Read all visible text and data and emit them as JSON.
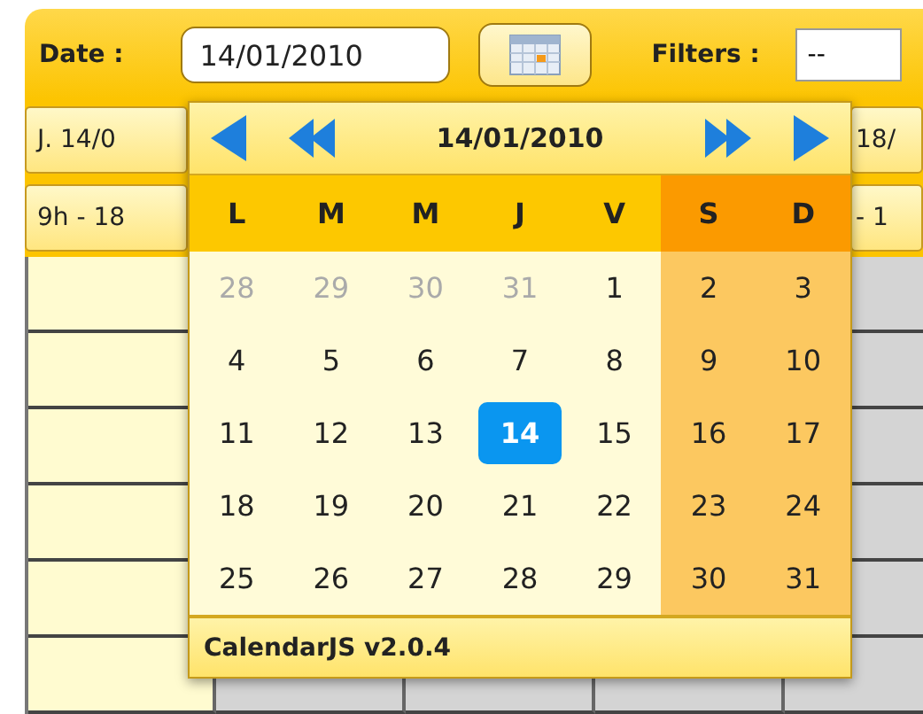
{
  "toolbar": {
    "date_label": "Date :",
    "date_value": "14/01/2010",
    "filters_label": "Filters :",
    "filters_value": "--"
  },
  "header_rows": [
    {
      "left": "J. 14/0",
      "right": "18/"
    },
    {
      "left": "9h - 18",
      "right": "- 1"
    }
  ],
  "calendar": {
    "title": "14/01/2010",
    "weekdays": [
      {
        "label": "L",
        "weekend": false
      },
      {
        "label": "M",
        "weekend": false
      },
      {
        "label": "M",
        "weekend": false
      },
      {
        "label": "J",
        "weekend": false
      },
      {
        "label": "V",
        "weekend": false
      },
      {
        "label": "S",
        "weekend": true
      },
      {
        "label": "D",
        "weekend": true
      }
    ],
    "weeks": [
      [
        {
          "day": "28",
          "other_month": true,
          "selected": false
        },
        {
          "day": "29",
          "other_month": true,
          "selected": false
        },
        {
          "day": "30",
          "other_month": true,
          "selected": false
        },
        {
          "day": "31",
          "other_month": true,
          "selected": false
        },
        {
          "day": "1",
          "other_month": false,
          "selected": false
        },
        {
          "day": "2",
          "other_month": false,
          "selected": false
        },
        {
          "day": "3",
          "other_month": false,
          "selected": false
        }
      ],
      [
        {
          "day": "4",
          "other_month": false,
          "selected": false
        },
        {
          "day": "5",
          "other_month": false,
          "selected": false
        },
        {
          "day": "6",
          "other_month": false,
          "selected": false
        },
        {
          "day": "7",
          "other_month": false,
          "selected": false
        },
        {
          "day": "8",
          "other_month": false,
          "selected": false
        },
        {
          "day": "9",
          "other_month": false,
          "selected": false
        },
        {
          "day": "10",
          "other_month": false,
          "selected": false
        }
      ],
      [
        {
          "day": "11",
          "other_month": false,
          "selected": false
        },
        {
          "day": "12",
          "other_month": false,
          "selected": false
        },
        {
          "day": "13",
          "other_month": false,
          "selected": false
        },
        {
          "day": "14",
          "other_month": false,
          "selected": true
        },
        {
          "day": "15",
          "other_month": false,
          "selected": false
        },
        {
          "day": "16",
          "other_month": false,
          "selected": false
        },
        {
          "day": "17",
          "other_month": false,
          "selected": false
        }
      ],
      [
        {
          "day": "18",
          "other_month": false,
          "selected": false
        },
        {
          "day": "19",
          "other_month": false,
          "selected": false
        },
        {
          "day": "20",
          "other_month": false,
          "selected": false
        },
        {
          "day": "21",
          "other_month": false,
          "selected": false
        },
        {
          "day": "22",
          "other_month": false,
          "selected": false
        },
        {
          "day": "23",
          "other_month": false,
          "selected": false
        },
        {
          "day": "24",
          "other_month": false,
          "selected": false
        }
      ],
      [
        {
          "day": "25",
          "other_month": false,
          "selected": false
        },
        {
          "day": "26",
          "other_month": false,
          "selected": false
        },
        {
          "day": "27",
          "other_month": false,
          "selected": false
        },
        {
          "day": "28",
          "other_month": false,
          "selected": false
        },
        {
          "day": "29",
          "other_month": false,
          "selected": false
        },
        {
          "day": "30",
          "other_month": false,
          "selected": false
        },
        {
          "day": "31",
          "other_month": false,
          "selected": false
        }
      ]
    ],
    "footer": "CalendarJS v2.0.4"
  }
}
